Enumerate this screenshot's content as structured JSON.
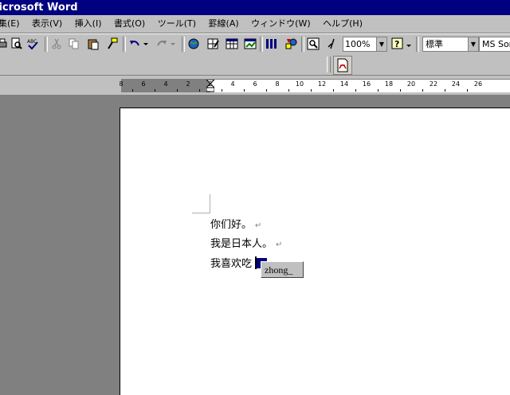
{
  "window": {
    "title": "licrosoft Word"
  },
  "menubar": {
    "items": [
      "集(E)",
      "表示(V)",
      "挿入(I)",
      "書式(O)",
      "ツール(T)",
      "罫線(A)",
      "ウィンドウ(W)",
      "ヘルプ(H)"
    ]
  },
  "toolbar": {
    "zoom_value": "100%",
    "style_value": "標準",
    "font_value": "MS Sor"
  },
  "ruler": {
    "labels": [
      "8",
      "6",
      "4",
      "2",
      "2",
      "4",
      "6",
      "8",
      "10",
      "12",
      "14",
      "16",
      "18",
      "20",
      "22",
      "24",
      "26"
    ]
  },
  "document": {
    "lines": [
      "你们好。",
      "我是日本人。",
      "我喜欢吃"
    ],
    "para_mark": "↵"
  },
  "ime": {
    "composition": "zhong_"
  },
  "colors": {
    "title_bg": "#000080",
    "chrome": "#c0c0c0",
    "workspace": "#808080",
    "page": "#ffffff",
    "cursor": "#000080"
  }
}
